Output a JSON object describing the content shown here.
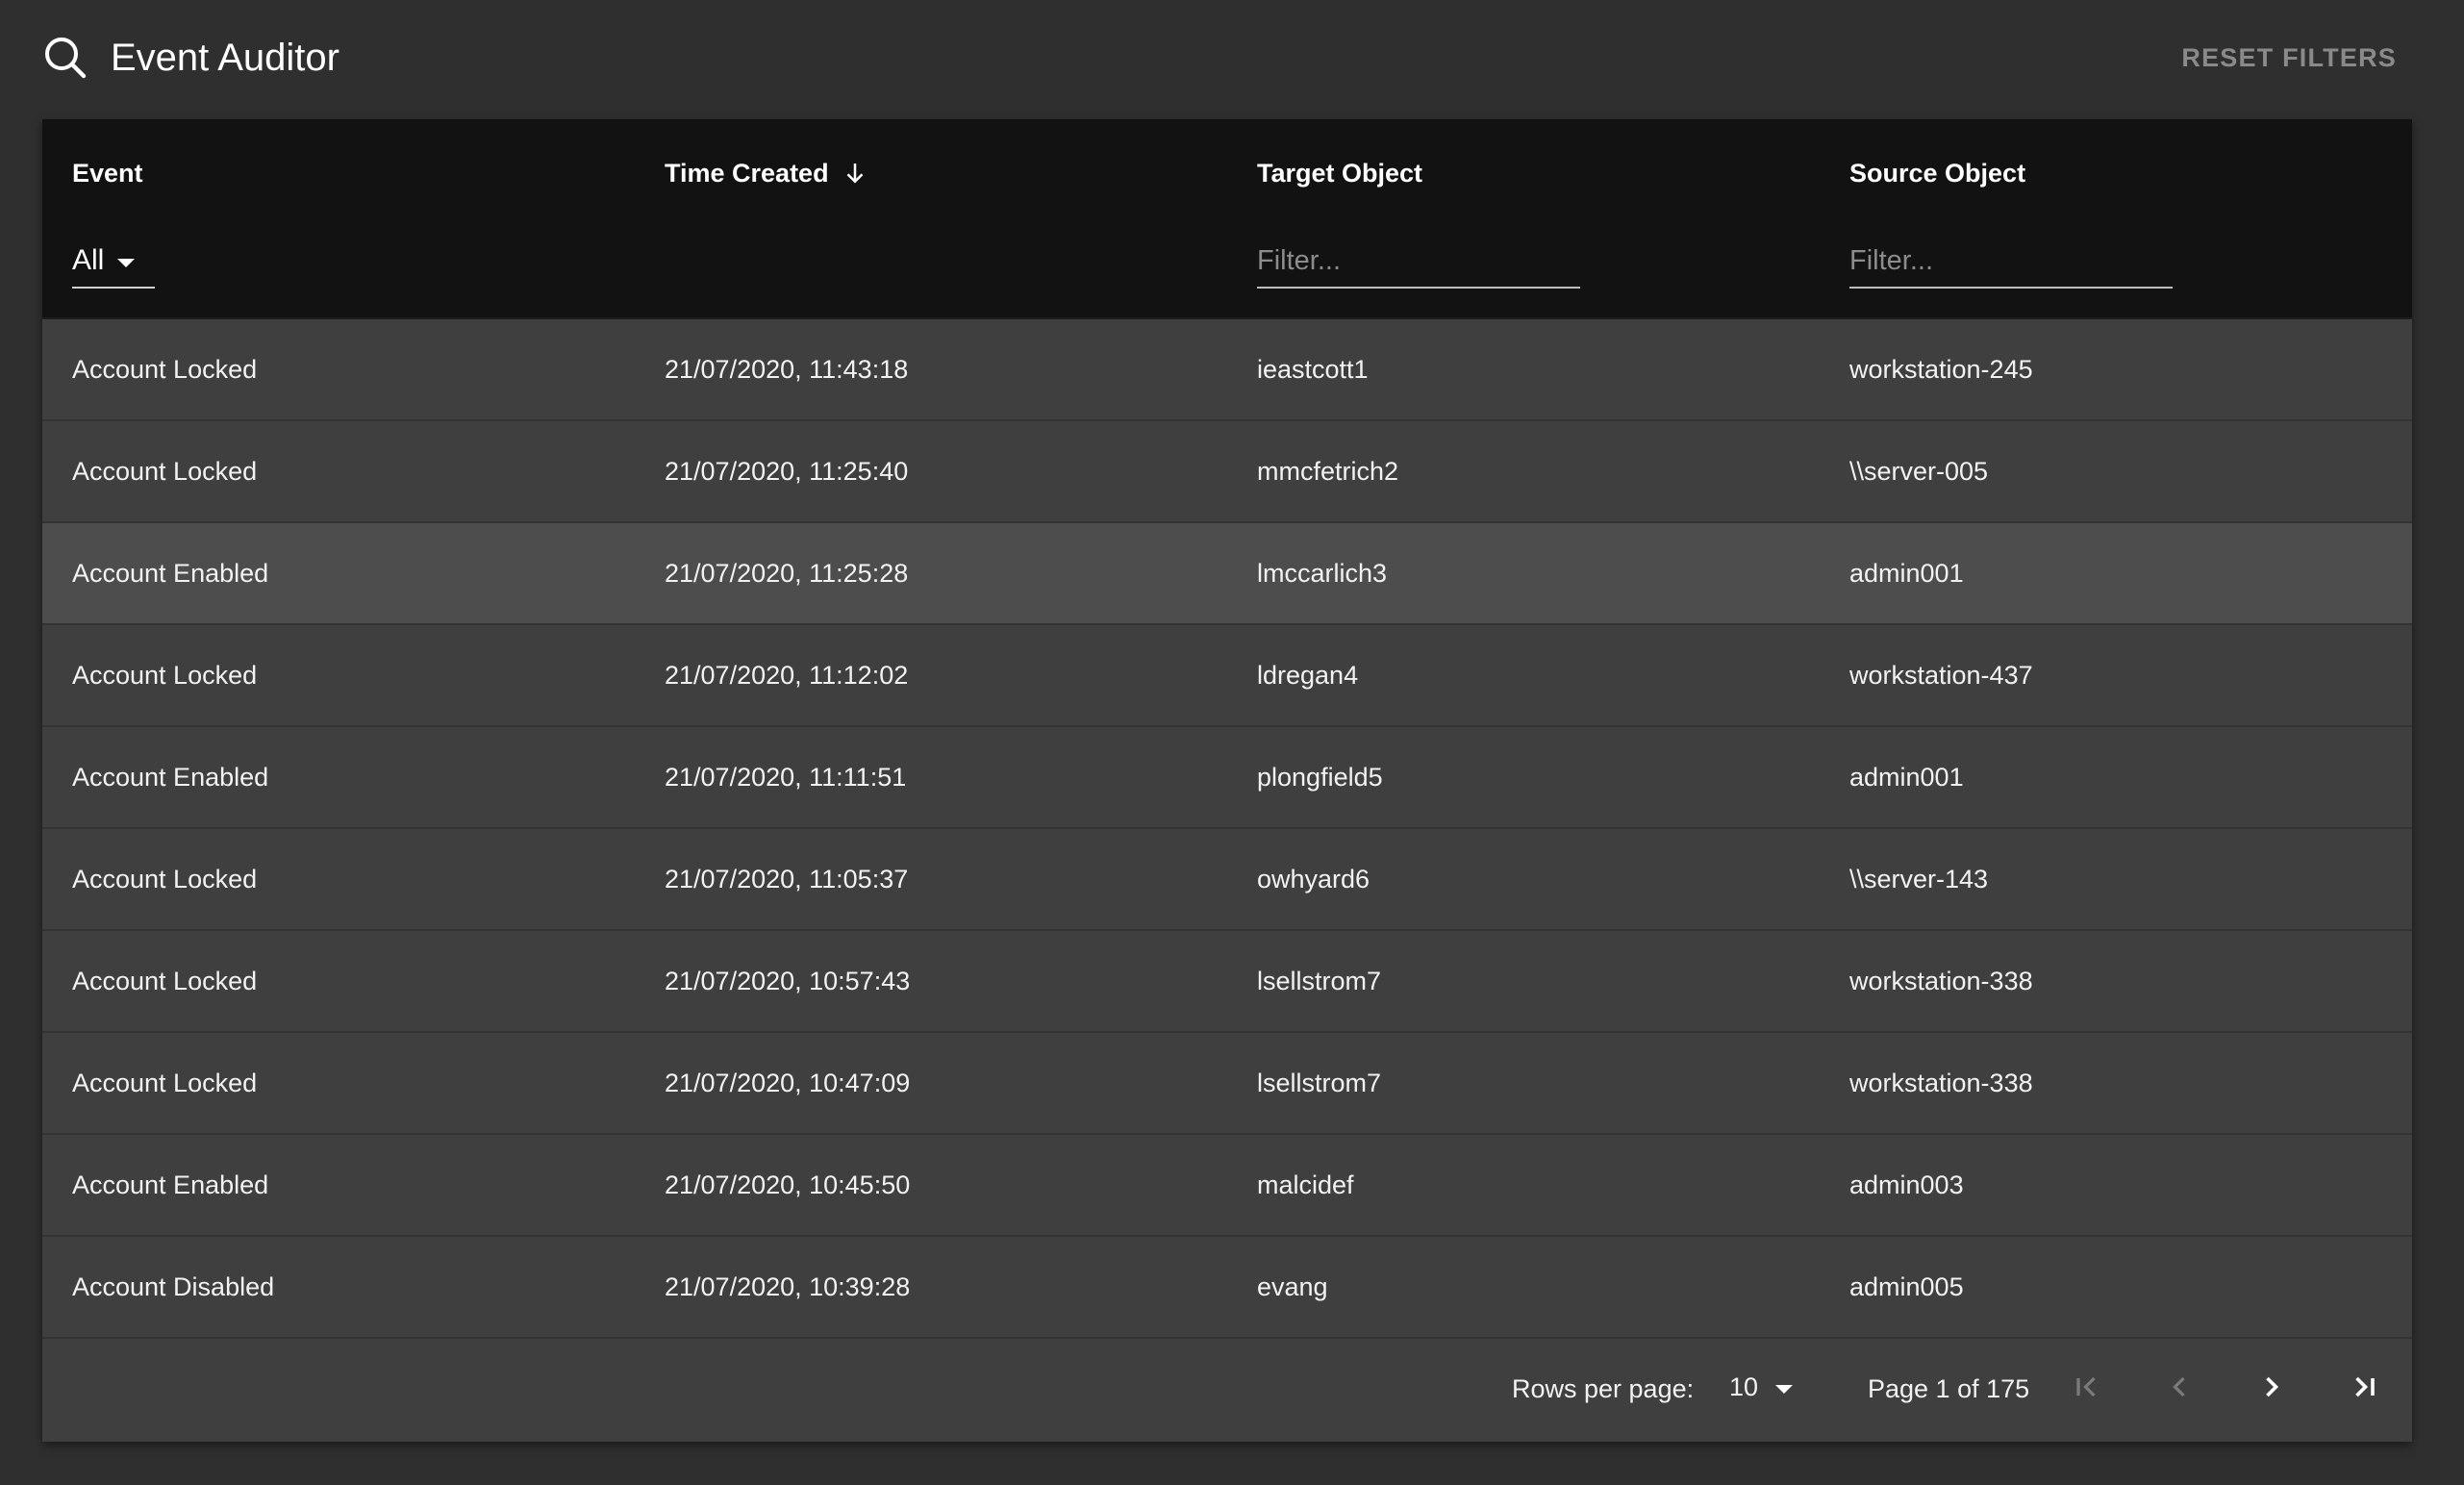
{
  "header": {
    "title": "Event Auditor",
    "reset_label": "RESET FILTERS",
    "search_icon": "search-icon"
  },
  "columns": {
    "event": "Event",
    "time": "Time Created",
    "target": "Target Object",
    "source": "Source Object"
  },
  "filters": {
    "event_value": "All",
    "target_placeholder": "Filter...",
    "source_placeholder": "Filter..."
  },
  "rows": [
    {
      "event": "Account Locked",
      "time": "21/07/2020, 11:43:18",
      "target": "ieastcott1",
      "source": "workstation-245"
    },
    {
      "event": "Account Locked",
      "time": "21/07/2020, 11:25:40",
      "target": "mmcfetrich2",
      "source": "\\\\server-005"
    },
    {
      "event": "Account Enabled",
      "time": "21/07/2020, 11:25:28",
      "target": "lmccarlich3",
      "source": "admin001"
    },
    {
      "event": "Account Locked",
      "time": "21/07/2020, 11:12:02",
      "target": "ldregan4",
      "source": "workstation-437"
    },
    {
      "event": "Account Enabled",
      "time": "21/07/2020, 11:11:51",
      "target": "plongfield5",
      "source": "admin001"
    },
    {
      "event": "Account Locked",
      "time": "21/07/2020, 11:05:37",
      "target": "owhyard6",
      "source": "\\\\server-143"
    },
    {
      "event": "Account Locked",
      "time": "21/07/2020, 10:57:43",
      "target": "lsellstrom7",
      "source": "workstation-338"
    },
    {
      "event": "Account Locked",
      "time": "21/07/2020, 10:47:09",
      "target": "lsellstrom7",
      "source": "workstation-338"
    },
    {
      "event": "Account Enabled",
      "time": "21/07/2020, 10:45:50",
      "target": "malcidef",
      "source": "admin003"
    },
    {
      "event": "Account Disabled",
      "time": "21/07/2020, 10:39:28",
      "target": "evang",
      "source": "admin005"
    }
  ],
  "pagination": {
    "rows_per_page_label": "Rows per page:",
    "rows_per_page_value": "10",
    "page_info": "Page 1 of 175"
  },
  "colors": {
    "background": "#2f2f2f",
    "panel": "#3f3f3f",
    "header_row": "#121212",
    "hover_row": "#4d4d4d",
    "muted_text": "#8a8a8a"
  }
}
